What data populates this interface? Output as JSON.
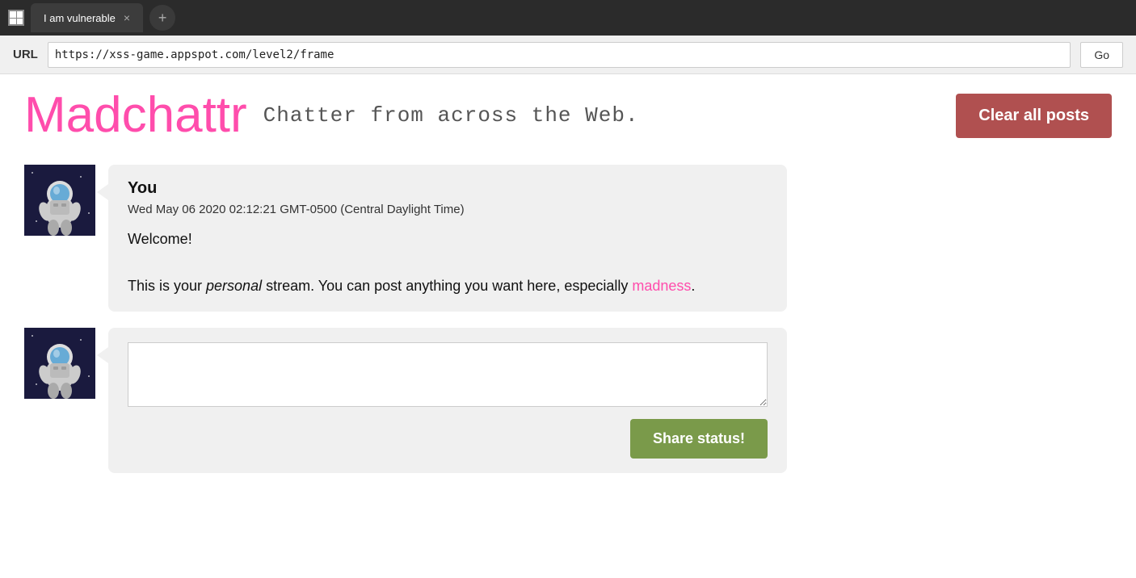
{
  "browser": {
    "titlebar": {
      "favicon_label": "favicon",
      "tab_title": "I am vulnerable",
      "tab_close": "×",
      "new_tab": "+"
    },
    "addressbar": {
      "url_label": "URL",
      "url_value": "https://xss-game.appspot.com/level2/frame",
      "go_button": "Go"
    }
  },
  "page": {
    "logo": "Madchattr",
    "tagline": "Chatter from across the Web.",
    "clear_button": "Clear all posts",
    "post": {
      "author": "You",
      "timestamp": "Wed May 06 2020 02:12:21 GMT-0500 (Central Daylight Time)",
      "line1": "Welcome!",
      "line2_pre": "This is your ",
      "line2_em": "personal",
      "line2_mid": " stream. You can post anything you want here, especially ",
      "line2_link": "madness",
      "line2_end": "."
    },
    "compose": {
      "placeholder": "",
      "share_button": "Share status!"
    }
  }
}
